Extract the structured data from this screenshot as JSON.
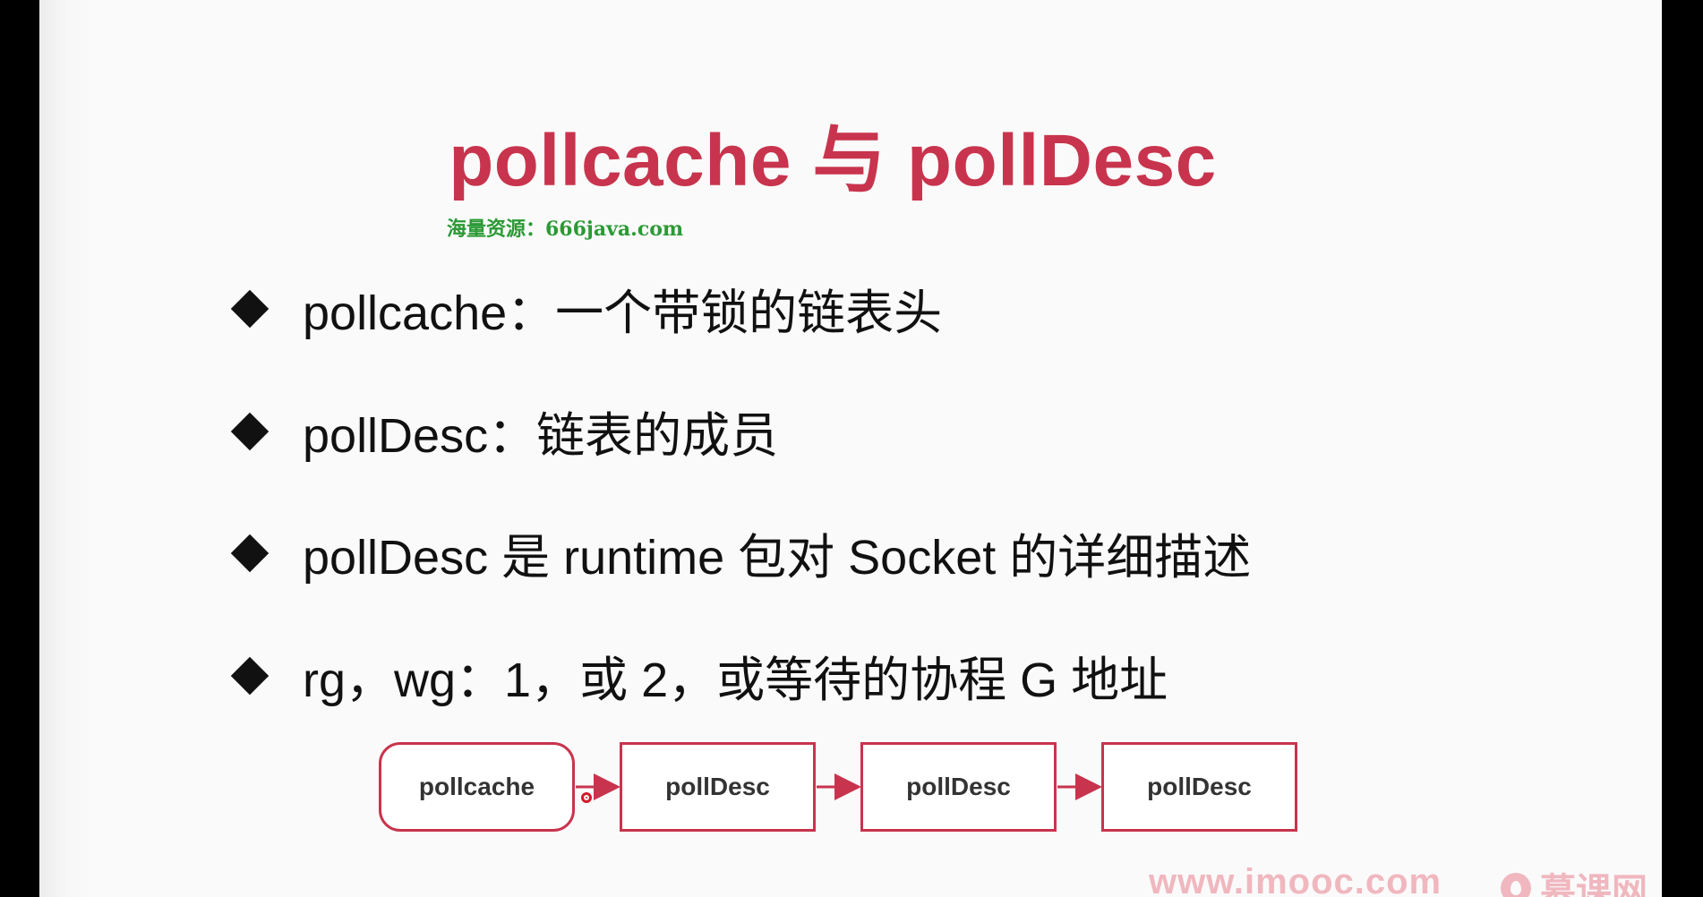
{
  "slide": {
    "title": "pollcache 与 pollDesc",
    "watermark": "海量资源：666java.com",
    "bullets": [
      "pollcache：一个带锁的链表头",
      "pollDesc：链表的成员",
      "pollDesc 是 runtime 包对 Socket 的详细描述",
      "rg，wg：1，或 2，或等待的协程 G 地址"
    ],
    "diagram": {
      "nodes": [
        "pollcache",
        "pollDesc",
        "pollDesc",
        "pollDesc"
      ]
    },
    "footer": {
      "url": "www.imooc.com",
      "brand": "慕课网"
    }
  },
  "colors": {
    "accent": "#c8344d",
    "watermark": "#2b9a35",
    "footer": "#f0b7bf"
  },
  "icons": [
    "bullet-diamond-icon",
    "arrow-right-icon",
    "imooc-logo-icon"
  ]
}
